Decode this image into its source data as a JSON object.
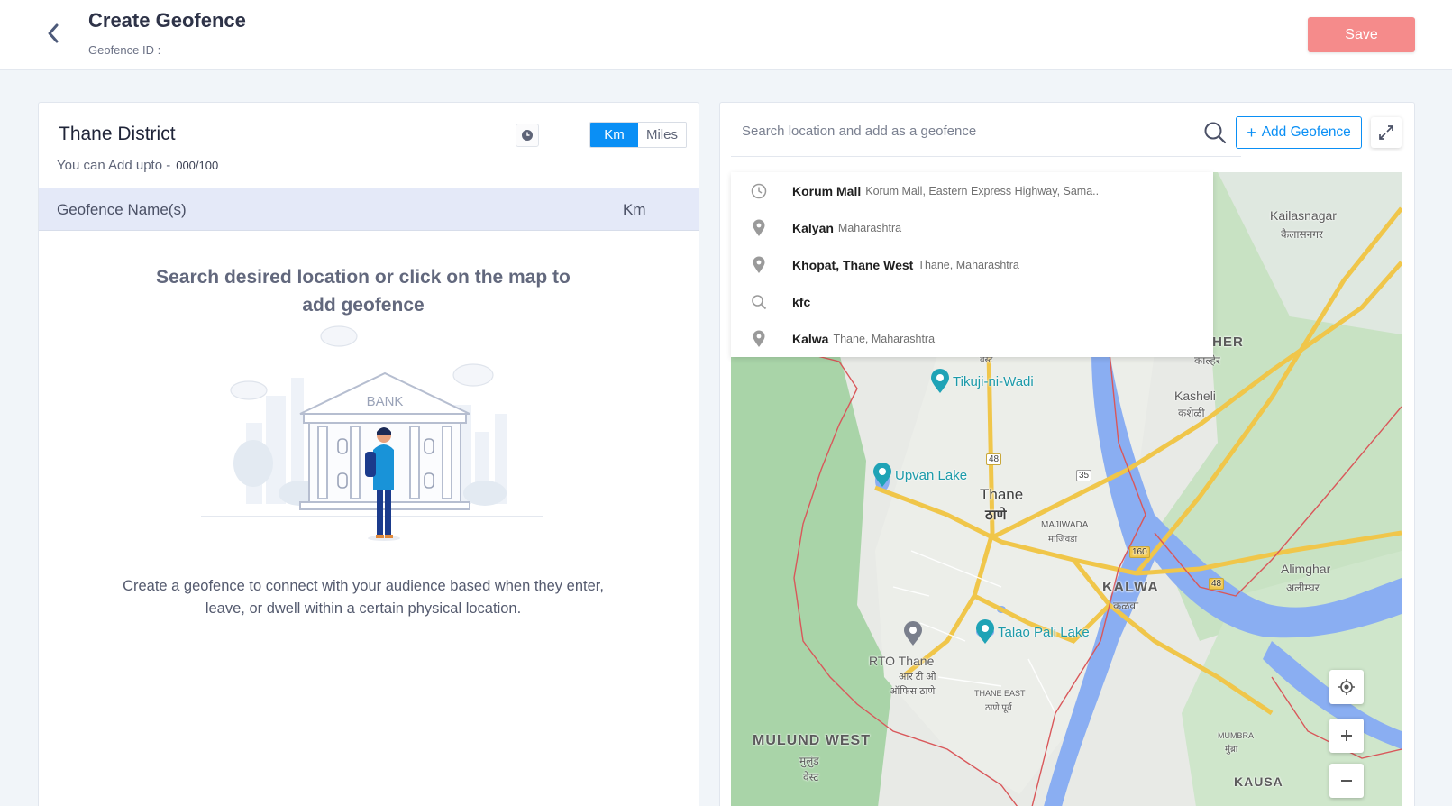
{
  "header": {
    "title": "Create Geofence",
    "geofence_id_label": "Geofence ID :",
    "save_label": "Save",
    "save_color": "#f58b8b"
  },
  "left": {
    "name_value": "Thane District",
    "unit_options": [
      "Km",
      "Miles"
    ],
    "unit_selected": "Km",
    "limit_text": "You can Add upto -",
    "limit_count": "000/100",
    "table_header": {
      "name": "Geofence Name(s)",
      "unit": "Km"
    },
    "empty_title": "Search desired location or click on the map to add geofence",
    "illustration_sign": "BANK",
    "empty_description": "Create a geofence to connect with your audience based when they enter, leave, or dwell within a certain physical location."
  },
  "right": {
    "search_placeholder": "Search location and add as a geofence",
    "add_button": "Add Geofence",
    "accent_color": "#0a8ff5",
    "suggestions": [
      {
        "icon": "clock-icon",
        "main": "Korum Mall",
        "sub": "Korum Mall, Eastern Express Highway, Sama.."
      },
      {
        "icon": "pin-icon",
        "main": "Kalyan",
        "sub": "Maharashtra"
      },
      {
        "icon": "pin-icon",
        "main": "Khopat, Thane West",
        "sub": "Thane, Maharashtra"
      },
      {
        "icon": "search-icon",
        "main": "kfc",
        "sub": ""
      },
      {
        "icon": "pin-icon",
        "main": "Kalwa",
        "sub": "Thane, Maharashtra"
      }
    ],
    "map_labels": {
      "kailasnagar": "Kailasnagar",
      "kailasnagar_mr": "कैलासनगर",
      "lher": "LHER",
      "lher_mr": "काल्हेर",
      "kasheli": "Kasheli",
      "kasheli_mr": "कशेळी",
      "tikuji": "Tikuji-ni-Wadi",
      "upvan": "Upvan Lake",
      "thane": "Thane",
      "thane_mr": "ठाणे",
      "majiwada": "MAJIWADA",
      "majiwada_mr": "माजिवडा",
      "kalwa": "KALWA",
      "kalwa_mr": "कळवा",
      "alimghar": "Alimghar",
      "alimghar_mr": "अलीम्घर",
      "talao": "Talao Pali Lake",
      "rto": "RTO Thane",
      "rto_mr1": "आर टी ओ",
      "rto_mr2": "ऑफिस ठाणे",
      "thane_east": "THANE EAST",
      "thane_east_mr": "ठाणे पूर्व",
      "mulund": "MULUND WEST",
      "mulund_mr1": "मुलुंड",
      "mulund_mr2": "वेस्ट",
      "mumbra": "MUMBRA",
      "mumbra_mr": "मुंब्रा",
      "kausa": "KAUSA",
      "west_frag": "वेस्ट",
      "hw_48a": "48",
      "hw_48b": "48",
      "hw_35": "35",
      "hw_160": "160"
    }
  }
}
